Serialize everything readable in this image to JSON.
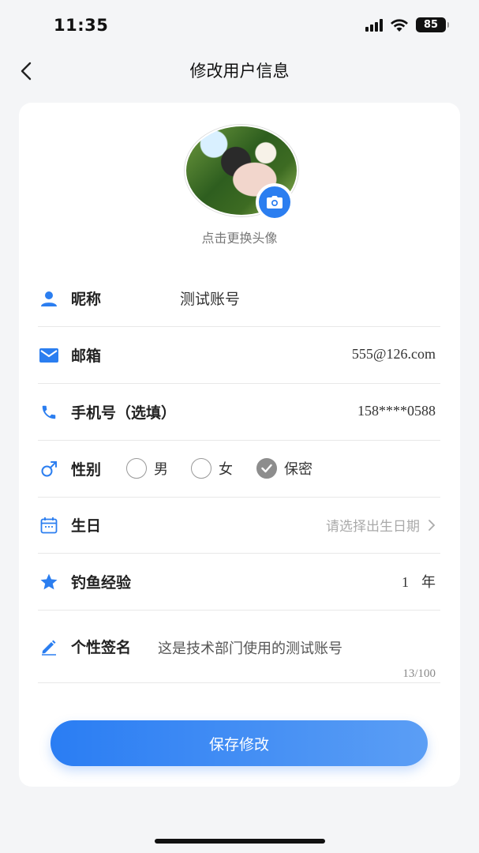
{
  "status": {
    "time": "11:35",
    "battery": "85"
  },
  "nav": {
    "title": "修改用户信息"
  },
  "avatar": {
    "hint": "点击更换头像"
  },
  "fields": {
    "nickname": {
      "label": "昵称",
      "value": "测试账号"
    },
    "email": {
      "label": "邮箱",
      "value": "555@126.com"
    },
    "phone": {
      "label": "手机号（选填）",
      "value": "158****0588"
    },
    "gender": {
      "label": "性别",
      "options": [
        "男",
        "女",
        "保密"
      ],
      "selected": "保密"
    },
    "birthday": {
      "label": "生日",
      "placeholder": "请选择出生日期"
    },
    "experience": {
      "label": "钓鱼经验",
      "value": "1",
      "unit": "年"
    },
    "signature": {
      "label": "个性签名",
      "value": "这是技术部门使用的测试账号",
      "counter": "13/100"
    }
  },
  "actions": {
    "save_label": "保存修改"
  },
  "colors": {
    "accent": "#2b7ef0",
    "radio_checked": "#8d8d8d"
  }
}
